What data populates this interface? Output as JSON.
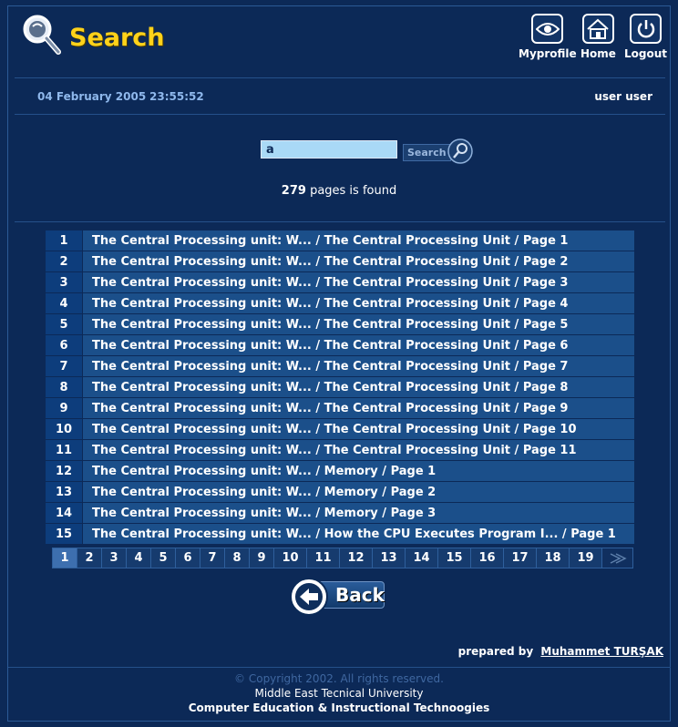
{
  "header": {
    "title": "Search",
    "nav": [
      {
        "label": "Myprofile",
        "icon": "eye-icon"
      },
      {
        "label": "Home",
        "icon": "house-icon"
      },
      {
        "label": "Logout",
        "icon": "power-icon"
      }
    ]
  },
  "status": {
    "date": "04 February 2005",
    "time": "23:55:52",
    "user": "user user"
  },
  "search": {
    "query": "a",
    "button_label": "Search",
    "result_count": "279",
    "result_suffix": "pages is found"
  },
  "results": [
    {
      "num": "1",
      "title": "The Central Processing unit: W... / The Central Processing Unit / Page 1"
    },
    {
      "num": "2",
      "title": "The Central Processing unit: W... / The Central Processing Unit / Page 2"
    },
    {
      "num": "3",
      "title": "The Central Processing unit: W... / The Central Processing Unit / Page 3"
    },
    {
      "num": "4",
      "title": "The Central Processing unit: W... / The Central Processing Unit / Page 4"
    },
    {
      "num": "5",
      "title": "The Central Processing unit: W... / The Central Processing Unit / Page 5"
    },
    {
      "num": "6",
      "title": "The Central Processing unit: W... / The Central Processing Unit / Page 6"
    },
    {
      "num": "7",
      "title": "The Central Processing unit: W... / The Central Processing Unit / Page 7"
    },
    {
      "num": "8",
      "title": "The Central Processing unit: W... / The Central Processing Unit / Page 8"
    },
    {
      "num": "9",
      "title": "The Central Processing unit: W... / The Central Processing Unit / Page 9"
    },
    {
      "num": "10",
      "title": "The Central Processing unit: W... / The Central Processing Unit / Page 10"
    },
    {
      "num": "11",
      "title": "The Central Processing unit: W... / The Central Processing Unit / Page 11"
    },
    {
      "num": "12",
      "title": "The Central Processing unit: W... / Memory / Page 1"
    },
    {
      "num": "13",
      "title": "The Central Processing unit: W... / Memory / Page 2"
    },
    {
      "num": "14",
      "title": "The Central Processing unit: W... / Memory / Page 3"
    },
    {
      "num": "15",
      "title": "The Central Processing unit: W... / How the CPU Executes Program I... / Page 1"
    }
  ],
  "pagination": {
    "pages": [
      "1",
      "2",
      "3",
      "4",
      "5",
      "6",
      "7",
      "8",
      "9",
      "10",
      "11",
      "12",
      "13",
      "14",
      "15",
      "16",
      "17",
      "18",
      "19"
    ],
    "current": "1",
    "next_icon": "next-arrow-icon"
  },
  "back_button": {
    "label": "Back",
    "icon": "back-arrow-icon"
  },
  "footer": {
    "prepared_by": "prepared by",
    "author": "Muhammet TURŞAK",
    "copyright": "© Copyright 2002. All rights reserved.",
    "university": "Middle East Tecnical University",
    "department": "Computer Education & Instructional Technoogies"
  },
  "colors": {
    "background": "#0c2957",
    "title": "#ffd21a",
    "row_bg": "#1b4f8a",
    "num_bg": "#0d3d7c",
    "date_text": "#8fb8ec"
  }
}
